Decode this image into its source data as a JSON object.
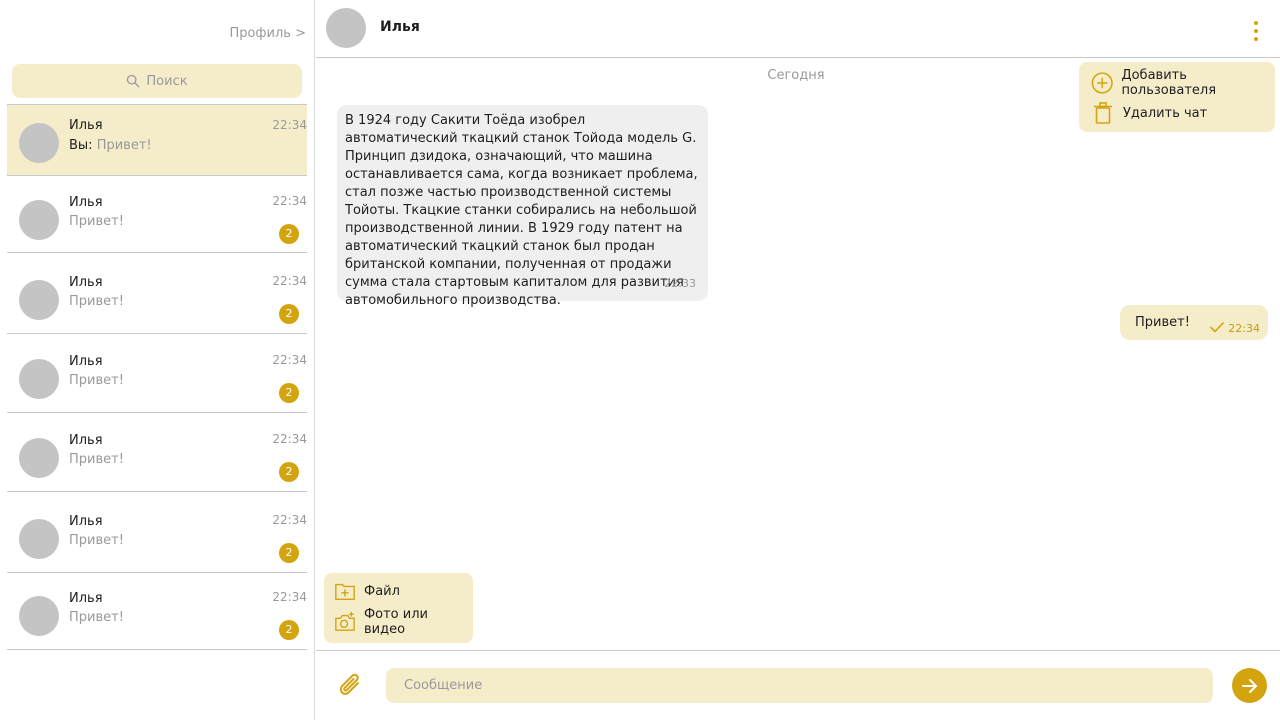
{
  "sidebar": {
    "profile_link": "Профиль >",
    "search_placeholder": "Поиск",
    "chats": [
      {
        "name": "Илья",
        "time": "22:34",
        "you_prefix": "Вы:",
        "preview": "Привет!",
        "unread": ""
      },
      {
        "name": "Илья",
        "time": "22:34",
        "you_prefix": "",
        "preview": "Привет!",
        "unread": "2"
      },
      {
        "name": "Илья",
        "time": "22:34",
        "you_prefix": "",
        "preview": "Привет!",
        "unread": "2"
      },
      {
        "name": "Илья",
        "time": "22:34",
        "you_prefix": "",
        "preview": "Привет!",
        "unread": "2"
      },
      {
        "name": "Илья",
        "time": "22:34",
        "you_prefix": "",
        "preview": "Привет!",
        "unread": "2"
      },
      {
        "name": "Илья",
        "time": "22:34",
        "you_prefix": "",
        "preview": "Привет!",
        "unread": "2"
      },
      {
        "name": "Илья",
        "time": "22:34",
        "you_prefix": "",
        "preview": "Привет!",
        "unread": "2"
      }
    ]
  },
  "header": {
    "name": "Илья",
    "menu_icon": "kebab-menu-icon"
  },
  "chat_menu": {
    "add_user": "Добавить пользователя",
    "delete_chat": "Удалить чат"
  },
  "date_label": "Сегодня",
  "messages": {
    "incoming": {
      "text": "В 1924 году Сакити Тоёда изобрел автоматический ткацкий станок Тойода модель G. Принцип дзидока, означающий, что машина останавливается сама, когда возникает проблема, стал позже частью производственной системы Тойоты. Ткацкие станки собирались на небольшой производственной линии. В 1929 году патент на автоматический ткацкий станок был продан британской компании, полученная от продажи сумма стала стартовым капиталом для развития автомобильного производства.",
      "time": "22:33"
    },
    "outgoing": {
      "text": "Привет!",
      "time": "22:34"
    }
  },
  "attach_menu": {
    "file": "Файл",
    "photo_video": "Фото или видео"
  },
  "composer": {
    "placeholder": "Сообщение"
  },
  "colors": {
    "accent": "#d4a40f",
    "accent_light": "#f5ecca",
    "avatar": "#c4c4c4"
  }
}
